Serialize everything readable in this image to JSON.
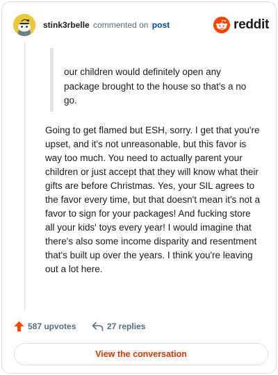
{
  "header": {
    "username": "stink3rbelle",
    "commented_text": "commented on",
    "post_link": "post",
    "brand_word": "reddit",
    "icons": {
      "avatar": "snoo-avatar",
      "brand": "reddit-snoo-logo"
    },
    "colors": {
      "brand": "#ff4500",
      "link": "#0045ac",
      "avatar_bg": "#e8c93a"
    }
  },
  "comment": {
    "quote": "our children would definitely open any package brought to the house so that's a no go.",
    "body": "Going to get flamed but ESH, sorry. I get that you're upset, and it's not unreasonable, but this favor is way too much. You need to actually parent your children or just accept that they will know what their gifts are before Christmas. Yes, your SIL agrees to the favor every time, but that doesn't mean it's not a favor to sign for your packages! And fucking store all your kids' toys every year! I would imagine that there's also some income disparity and resentment that's built up over the years. I think you're leaving out a lot here."
  },
  "actions": {
    "upvotes": "587 upvotes",
    "replies": "27 replies",
    "icons": {
      "upvote": "upvote-arrow-icon",
      "reply": "reply-arrow-icon"
    },
    "colors": {
      "upvote": "#ff4500",
      "text": "#576f76"
    }
  },
  "cta": {
    "label": "View the conversation",
    "color": "#d93a00"
  }
}
